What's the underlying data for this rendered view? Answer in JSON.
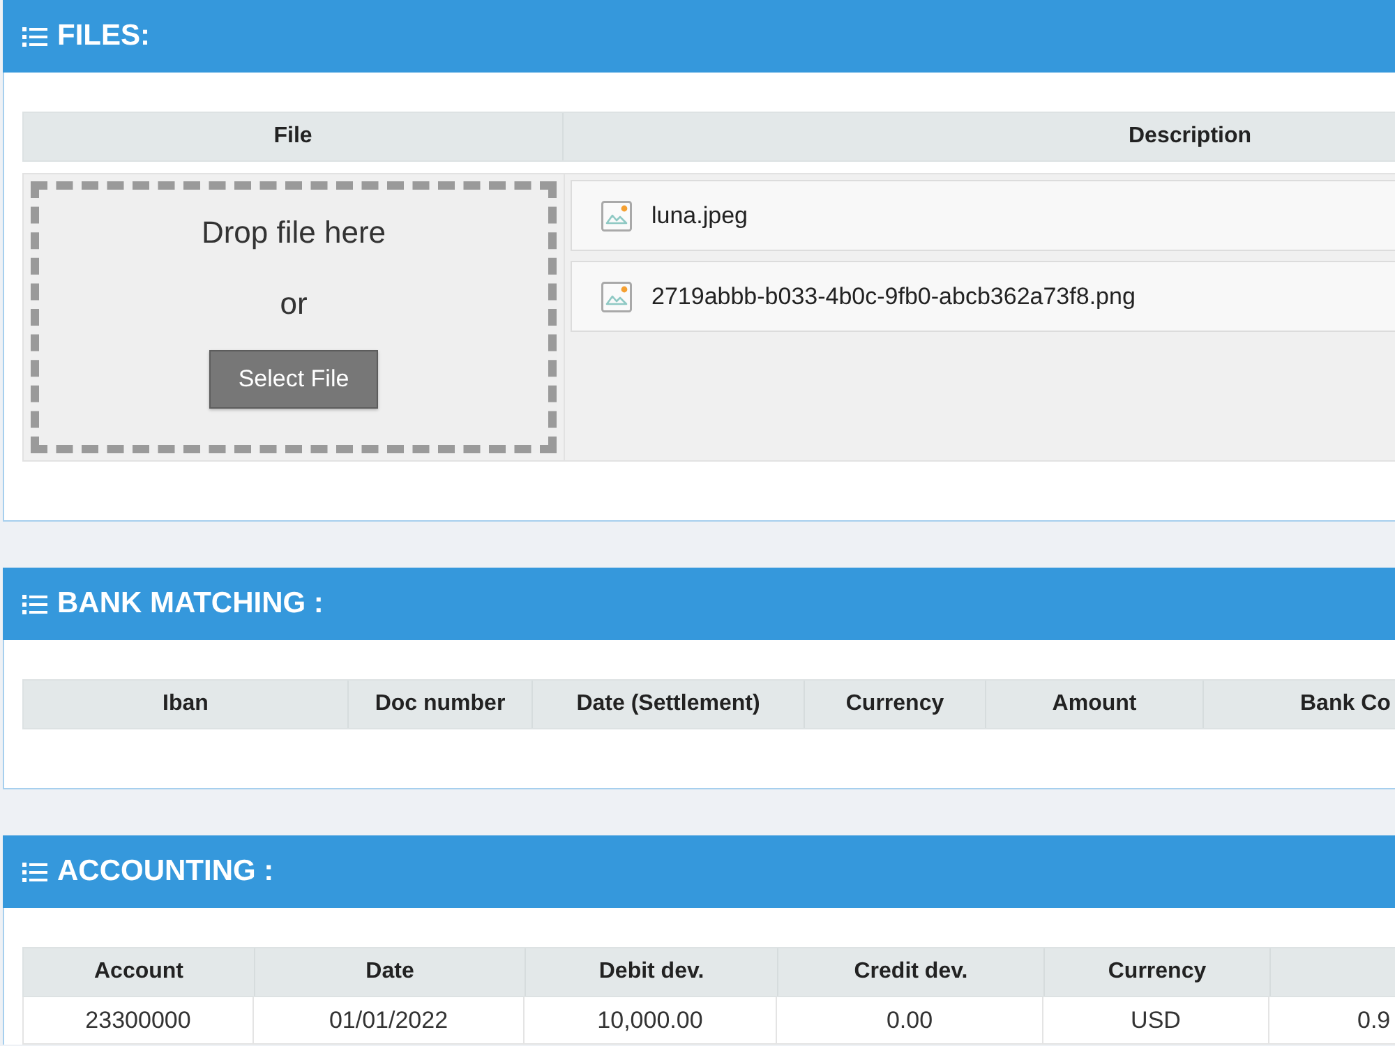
{
  "sections": [
    {
      "kind": "files",
      "title": "FILES:",
      "columns": [
        "File",
        "Description"
      ],
      "drop_zone": {
        "text": "Drop file here",
        "separator": "or",
        "button": "Select File"
      },
      "files": [
        {
          "name": "luna.jpeg"
        },
        {
          "name": "2719abbb-b033-4b0c-9fb0-abcb362a73f8.png"
        }
      ]
    },
    {
      "kind": "table",
      "title": "BANK MATCHING :",
      "columns": [
        "Iban",
        "Doc number",
        "Date (Settlement)",
        "Currency",
        "Amount",
        "Bank Co"
      ]
    },
    {
      "kind": "table",
      "title": "ACCOUNTING :",
      "columns": [
        "Account",
        "Date",
        "Debit dev.",
        "Credit dev.",
        "Currency"
      ],
      "rows": [
        [
          "23300000",
          "01/01/2022",
          "10,000.00",
          "0.00",
          "USD",
          "0.9"
        ]
      ]
    }
  ]
}
